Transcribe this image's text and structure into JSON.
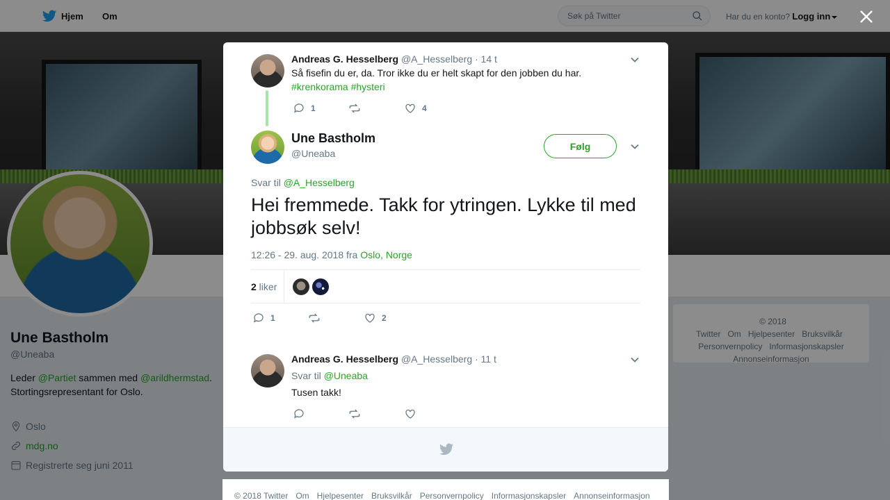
{
  "nav": {
    "home_label": "Hjem",
    "about_label": "Om",
    "search_placeholder": "Søk på Twitter",
    "account_prompt": "Har du en konto?",
    "login_label": "Logg inn"
  },
  "profile": {
    "name": "Une Bastholm",
    "handle": "@Uneaba",
    "bio_1": "Leder ",
    "bio_link_1": "@Partiet",
    "bio_2": " sammen med ",
    "bio_link_2": "@arildhermstad",
    "bio_3": ". Stortingsrepresentant for Oslo.",
    "location": "Oslo",
    "website": "mdg.no",
    "joined": "Registrerte seg juni 2011"
  },
  "side_footer": [
    "© 2018 Twitter",
    "Om",
    "Hjelpesenter",
    "Bruksvilkår",
    "Personvernpolicy",
    "Informasjonskapsler",
    "Annonseinformasjon"
  ],
  "parent_tweet": {
    "name": "Andreas G. Hesselberg",
    "handle": "@A_Hesselberg",
    "time": "· 14 t",
    "text": "Så fisefin du er, da. Tror ikke du er helt skapt for den jobben du har.",
    "hashtag_1": "#krenkorama",
    "hashtag_2": "#hysteri",
    "replies": "1",
    "likes": "4"
  },
  "main_tweet": {
    "name": "Une Bastholm",
    "handle": "@Uneaba",
    "follow_label": "Følg",
    "reply_prefix": "Svar til ",
    "reply_to": "@A_Hesselberg",
    "text": "Hei fremmede. Takk for ytringen. Lykke til med jobbsøk selv!",
    "timestamp": "12:26 - 29. aug. 2018 fra ",
    "place_city": "Oslo",
    "place_sep": ", ",
    "place_country": "Norge",
    "likes_count": "2",
    "likes_label": " liker",
    "replies": "1",
    "likes": "2"
  },
  "reply_tweet": {
    "name": "Andreas G. Hesselberg",
    "handle": "@A_Hesselberg",
    "time": "· 11 t",
    "reply_prefix": "Svar til ",
    "reply_to": "@Uneaba",
    "text": "Tusen takk!"
  },
  "page_footer": [
    "© 2018 Twitter",
    "Om",
    "Hjelpesenter",
    "Bruksvilkår",
    "Personvernpolicy",
    "Informasjonskapsler",
    "Annonseinformasjon"
  ],
  "colors": {
    "accent": "#29a329",
    "muted": "#657786",
    "brand": "#1da1f2"
  }
}
